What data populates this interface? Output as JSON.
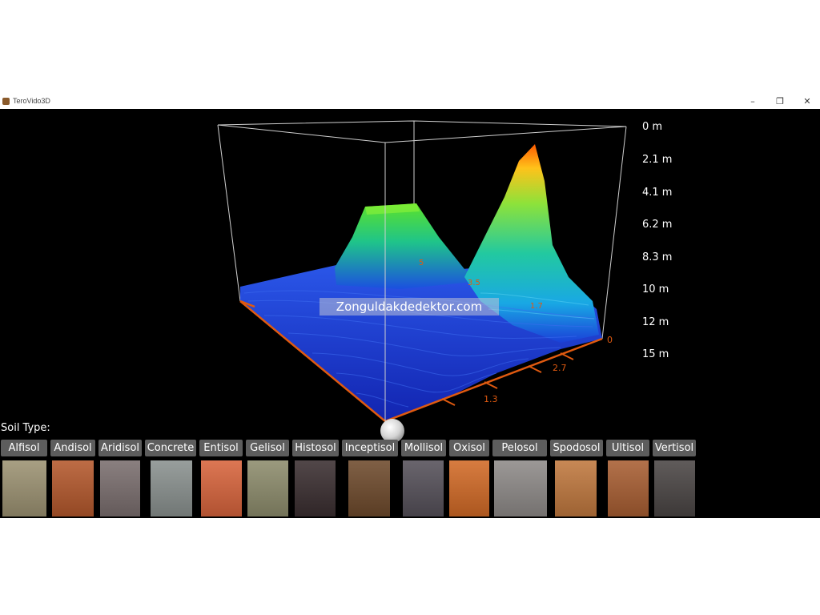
{
  "window": {
    "title": "TeroVido3D",
    "minimize_glyph": "–",
    "maximize_glyph": "❐",
    "close_glyph": "✕",
    "icon": "soil-app-icon"
  },
  "plot": {
    "depth_axis": [
      "0 m",
      "2.1 m",
      "4.1 m",
      "6.2 m",
      "8.3 m",
      "10 m",
      "12 m",
      "15 m"
    ],
    "floor_ticks": [
      "1.3",
      "2.7"
    ],
    "corner_label": "0",
    "annotations": [
      "5",
      "3.5",
      "1.7"
    ],
    "colors": {
      "axis_orange": "#e05a10",
      "box_line": "#d8d8d8",
      "surface_low": "#1a2fd6",
      "surface_mid": "#19c27a",
      "surface_high": "#ff6a00"
    }
  },
  "watermark": "Zonguldakdedektor.com",
  "soil": {
    "label": "Soil Type:",
    "types": [
      {
        "name": "Alfisol",
        "color": "#9c9272"
      },
      {
        "name": "Andisol",
        "color": "#b4582c"
      },
      {
        "name": "Aridisol",
        "color": "#7a6e6e"
      },
      {
        "name": "Concrete",
        "color": "#8a918f"
      },
      {
        "name": "Entisol",
        "color": "#d8643c"
      },
      {
        "name": "Gelisol",
        "color": "#8d8c6c"
      },
      {
        "name": "Histosol",
        "color": "#3a2e30"
      },
      {
        "name": "Inceptisol",
        "color": "#6e4a2c"
      },
      {
        "name": "Mollisol",
        "color": "#555059"
      },
      {
        "name": "Oxisol",
        "color": "#d26a26"
      },
      {
        "name": "Pelosol",
        "color": "#8e8a88"
      },
      {
        "name": "Spodosol",
        "color": "#c0783e"
      },
      {
        "name": "Ultisol",
        "color": "#a85e32"
      },
      {
        "name": "Vertisol",
        "color": "#4a4544"
      }
    ]
  }
}
